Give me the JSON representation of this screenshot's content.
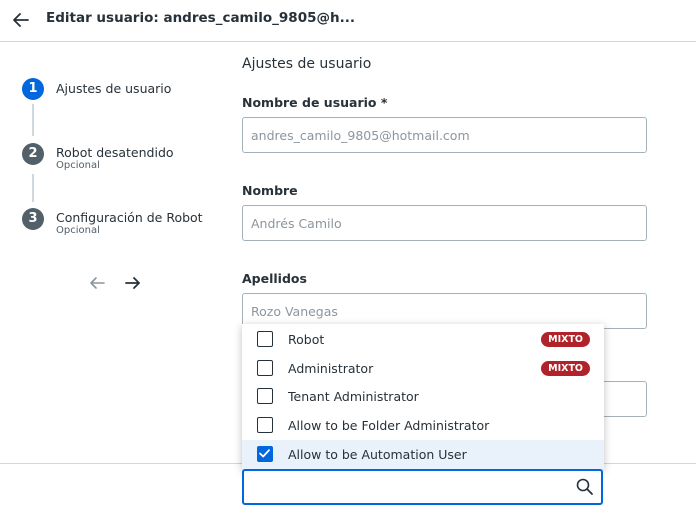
{
  "header": {
    "title": "Editar usuario: andres_camilo_9805@h..."
  },
  "stepper": {
    "steps": [
      {
        "number": "1",
        "label": "Ajustes de usuario",
        "sublabel": "",
        "state": "active"
      },
      {
        "number": "2",
        "label": "Robot desatendido",
        "sublabel": "Opcional",
        "state": "inactive"
      },
      {
        "number": "3",
        "label": "Configuración de Robot",
        "sublabel": "Opcional",
        "state": "inactive"
      }
    ]
  },
  "form": {
    "section_title": "Ajustes de usuario",
    "username": {
      "label": "Nombre de usuario *",
      "value": "andres_camilo_9805@hotmail.com"
    },
    "name": {
      "label": "Nombre",
      "value": "Andrés Camilo"
    },
    "lastname": {
      "label": "Apellidos",
      "value": "Rozo Vanegas"
    }
  },
  "dropdown": {
    "items": [
      {
        "label": "Robot",
        "checked": false,
        "badge": "MIXTO"
      },
      {
        "label": "Administrator",
        "checked": false,
        "badge": "MIXTO"
      },
      {
        "label": "Tenant Administrator",
        "checked": false,
        "badge": ""
      },
      {
        "label": "Allow to be Folder Administrator",
        "checked": false,
        "badge": ""
      },
      {
        "label": "Allow to be Automation User",
        "checked": true,
        "badge": ""
      }
    ],
    "search_value": ""
  },
  "colors": {
    "accent": "#0067df",
    "badge": "#b0232a",
    "selected_row": "#e9f1fa"
  }
}
